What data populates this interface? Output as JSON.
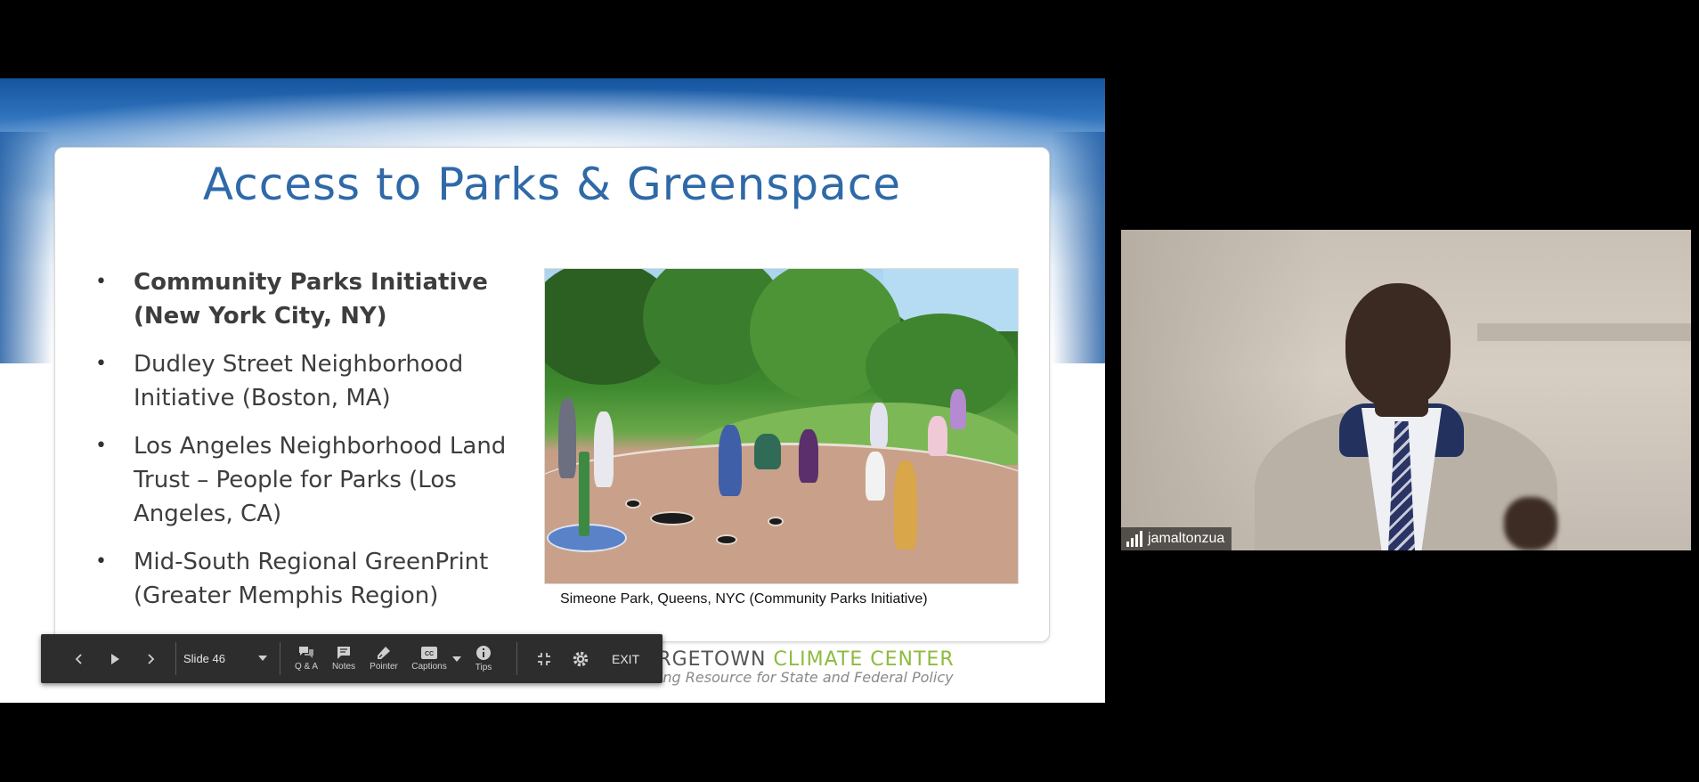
{
  "slide": {
    "title": "Access to Parks & Greenspace",
    "bullets": [
      {
        "text": "Community Parks Initiative (New York City, NY)",
        "bold": true
      },
      {
        "text": "Dudley Street Neighborhood Initiative (Boston, MA)",
        "bold": false
      },
      {
        "text": "Los Angeles Neighborhood Land Trust – People for Parks (Los Angeles, CA)",
        "bold": false
      },
      {
        "text": "Mid-South Regional GreenPrint (Greater Memphis Region)",
        "bold": false
      }
    ],
    "bullet_glyph": "•",
    "photo_caption": "Simeone Park, Queens, NYC (Community Parks Initiative)",
    "logo": {
      "line1_part1": "ORGETOWN ",
      "line1_part2": "CLIMATE CENTER",
      "line2": "ading Resource for State and Federal Policy"
    },
    "colors": {
      "title": "#2f69a8",
      "logo_green": "#8dbb3f"
    }
  },
  "toolbar": {
    "prev_icon": "chevron-left-icon",
    "play_icon": "play-icon",
    "next_icon": "chevron-right-icon",
    "slide_label": "Slide 46",
    "qa_label": "Q & A",
    "notes_label": "Notes",
    "pointer_label": "Pointer",
    "captions_label": "Captions",
    "tips_label": "Tips",
    "exit_label": "EXIT"
  },
  "video": {
    "participant_name": "jamaltonzua",
    "signal_icon": "signal-strength-icon"
  }
}
